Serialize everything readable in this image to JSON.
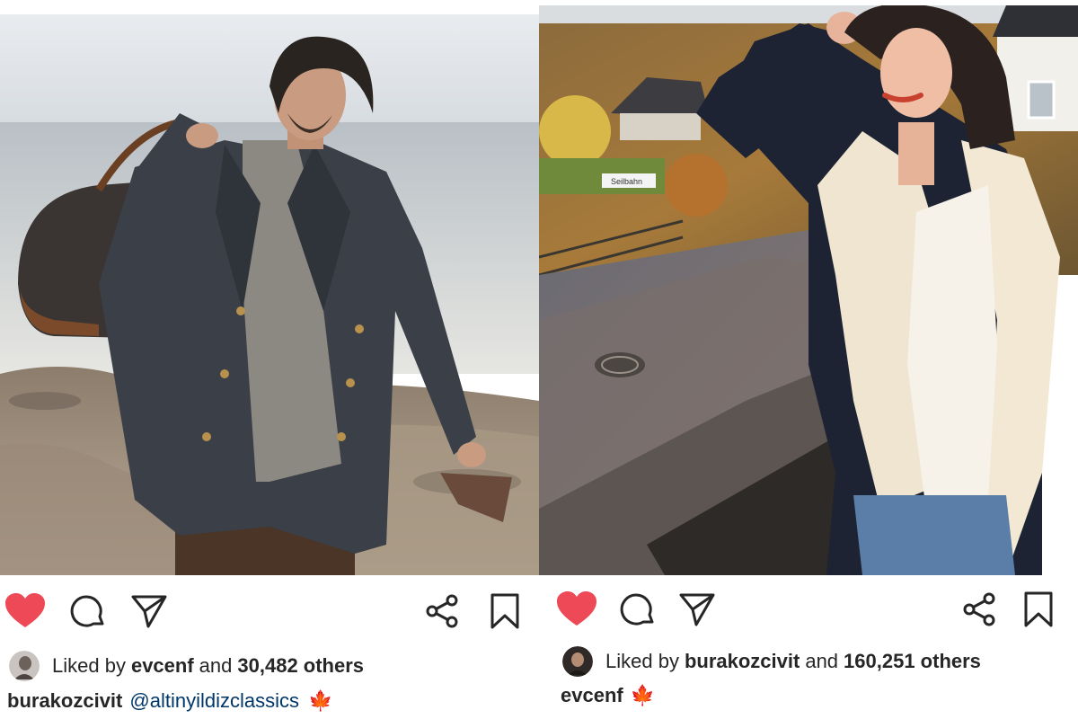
{
  "colors": {
    "heart": "#ed4956",
    "text": "#262626",
    "mention": "#00376b",
    "leaf": "#e0a23a"
  },
  "posts": [
    {
      "photo_subject": "man in dark coat on rocky shore holding leather bag",
      "actions": [
        "heart-icon",
        "comment-icon",
        "send-icon",
        "share-icon",
        "bookmark-icon"
      ],
      "likes": {
        "prefix": "Liked by",
        "user": "evcenf",
        "conjunction": "and",
        "count": "30,482 others"
      },
      "caption": {
        "user": "burakozcivit",
        "mention": "@altinyildizclassics",
        "emoji": "🍁"
      }
    },
    {
      "photo_subject": "woman in shearling jacket on sunny street",
      "actions": [
        "heart-icon",
        "comment-icon",
        "send-icon",
        "share-icon",
        "bookmark-icon"
      ],
      "sign_text": "Seilbahn",
      "likes": {
        "prefix": "Liked by",
        "user": "burakozcivit",
        "conjunction": "and",
        "count": "160,251 others"
      },
      "caption": {
        "user": "evcenf",
        "emoji": "🍁"
      }
    }
  ]
}
